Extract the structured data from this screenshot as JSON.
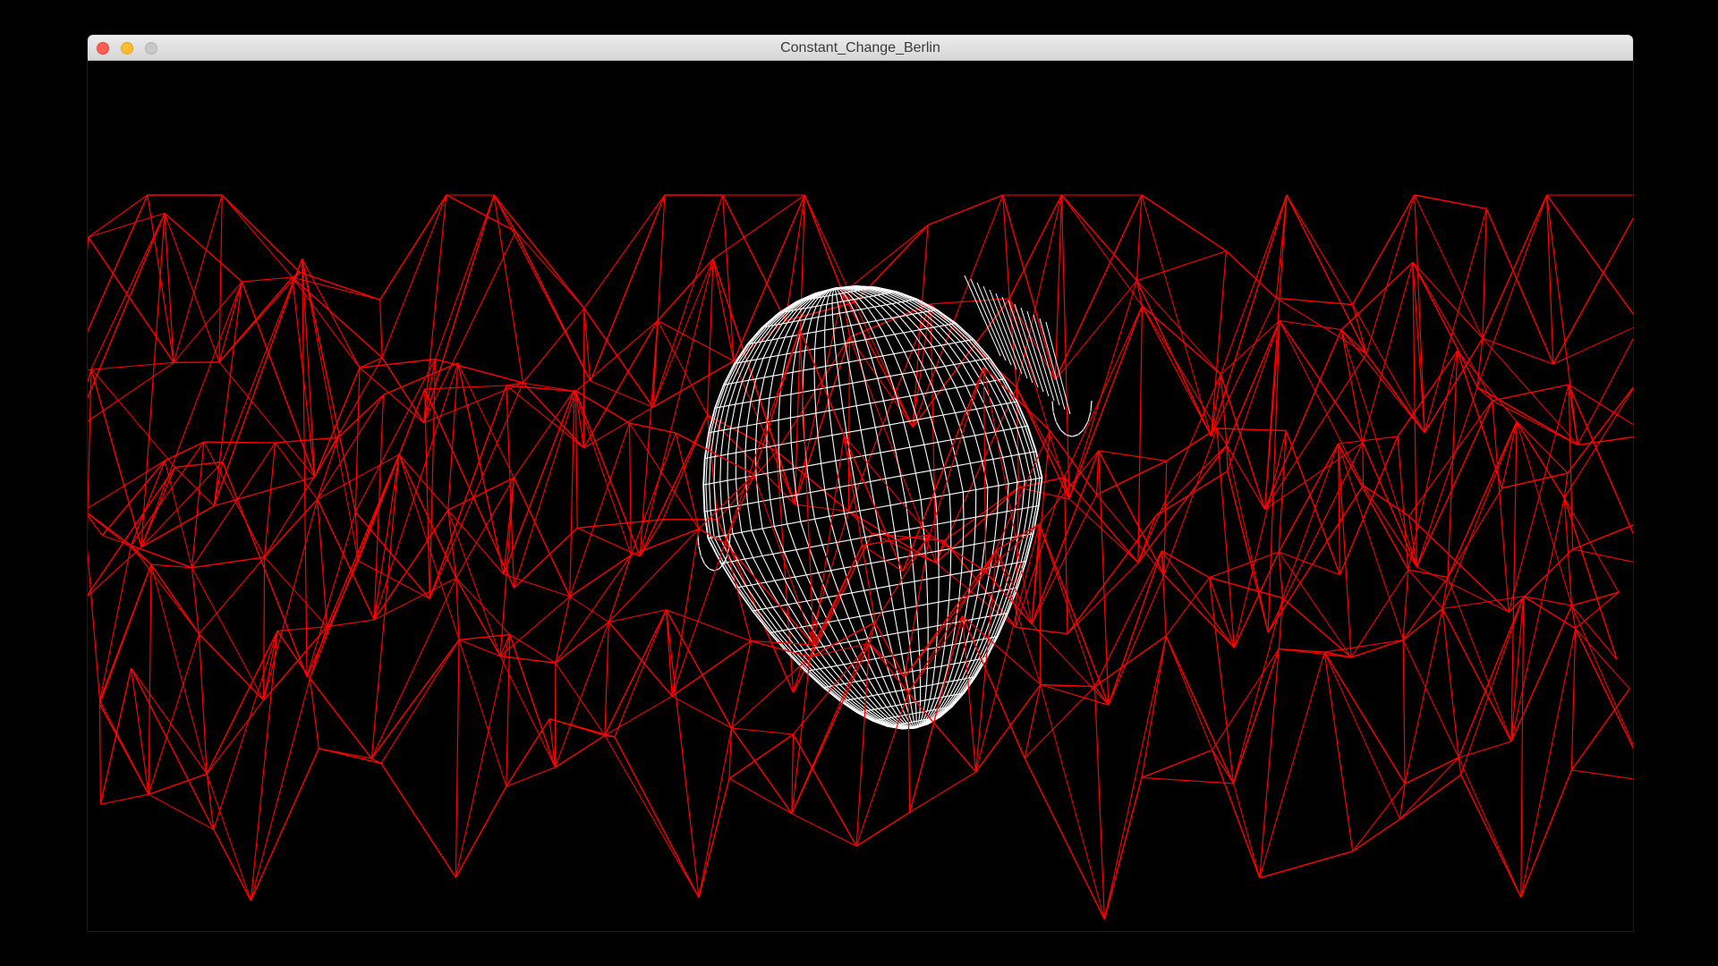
{
  "window": {
    "title": "Constant_Change_Berlin",
    "controls": {
      "close": "close-button",
      "minimize": "minimize-button",
      "zoom": "zoom-button"
    }
  },
  "scene": {
    "background_color": "#000000",
    "terrain_color": "#ff0000",
    "head_color": "#ffffff",
    "terrain_style": "wireframe-mountains",
    "head_style": "wireframe-head"
  }
}
